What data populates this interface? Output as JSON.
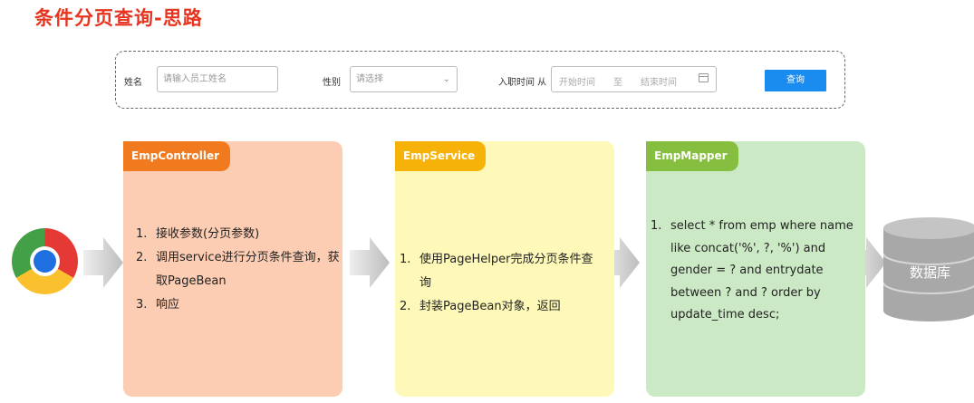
{
  "title": "条件分页查询-思路",
  "search_form": {
    "name_label": "姓名",
    "name_placeholder": "请输入员工姓名",
    "gender_label": "性别",
    "gender_placeholder": "请选择",
    "entry_label": "入职时间 从",
    "start_placeholder": "开始时间",
    "range_sep": "至",
    "end_placeholder": "结束时间",
    "search_button": "查询"
  },
  "panels": [
    {
      "name": "EmpController",
      "header_color": "#f27a1e",
      "body_color": "#fdcdb3",
      "items": [
        "接收参数(分页参数)",
        "调用service进行分页条件查询，获取PageBean",
        "响应"
      ]
    },
    {
      "name": "EmpService",
      "header_color": "#f7b20a",
      "body_color": "#fef9b8",
      "items": [
        "使用PageHelper完成分页条件查询",
        "封装PageBean对象，返回"
      ]
    },
    {
      "name": "EmpMapper",
      "header_color": "#86bf3f",
      "body_color": "#cce9c5",
      "items": [
        "select * from emp where name like concat('%', ?, '%') and gender = ? and entrydate between ? and ?  order by update_time desc;"
      ]
    }
  ],
  "database_label": "数据库"
}
